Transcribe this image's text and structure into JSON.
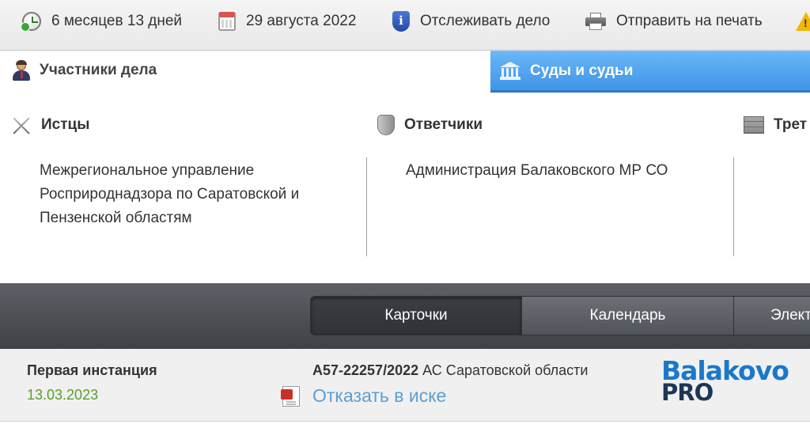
{
  "toolbar": {
    "duration": "6 месяцев 13 дней",
    "date": "29 августа 2022",
    "track": "Отслеживать дело",
    "print": "Отправить на печать"
  },
  "tabs": {
    "participants": "Участники дела",
    "courts": "Суды и судьи"
  },
  "parties": {
    "plaintiffs": {
      "title": "Истцы",
      "lines": [
        "Межрегиональное управление",
        "Росприроднадзора по Саратовской и",
        "Пензенской областям"
      ]
    },
    "defendants": {
      "title": "Ответчики",
      "lines": [
        "Администрация Балаковского МР СО"
      ]
    },
    "third": {
      "title": "Трет"
    }
  },
  "view_tabs": [
    "Карточки",
    "Календарь",
    "Элект"
  ],
  "instance": {
    "label": "Первая инстанция",
    "date": "13.03.2023",
    "case_number": "А57-22257/2022",
    "court": "АС Саратовской области",
    "result": "Отказать в иске"
  },
  "logo": {
    "line1": "Balakovo",
    "line2": "PRO"
  },
  "colors": {
    "active_tab": "#4a9ff0",
    "date_green": "#5a9e2c",
    "link_blue": "#5a9fd4",
    "dark_bar": "#4a4d52"
  }
}
